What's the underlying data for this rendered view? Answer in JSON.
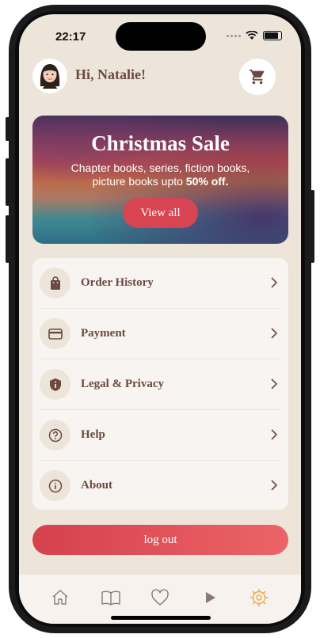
{
  "status_bar": {
    "time": "22:17"
  },
  "header": {
    "greeting": "Hi, Natalie!"
  },
  "banner": {
    "title": "Christmas Sale",
    "subtitle_line1": "Chapter books, series, fiction books,",
    "subtitle_line2_prefix": "picture books upto ",
    "subtitle_highlight": "50% off.",
    "button_label": "View all"
  },
  "menu": {
    "items": [
      {
        "label": "Order History",
        "icon": "shopping-bag-icon"
      },
      {
        "label": "Payment",
        "icon": "credit-card-icon"
      },
      {
        "label": "Legal & Privacy",
        "icon": "shield-icon"
      },
      {
        "label": "Help",
        "icon": "help-circle-icon"
      },
      {
        "label": "About",
        "icon": "info-icon"
      }
    ]
  },
  "logout_label": "log out",
  "tab_bar": {
    "tabs": [
      {
        "icon": "home-icon"
      },
      {
        "icon": "book-icon"
      },
      {
        "icon": "heart-icon"
      },
      {
        "icon": "play-icon"
      },
      {
        "icon": "settings-icon",
        "active": true
      }
    ]
  },
  "colors": {
    "accent": "#d84451",
    "text": "#6b4a40",
    "background": "#ede4da",
    "active_tab": "#f0a948"
  }
}
